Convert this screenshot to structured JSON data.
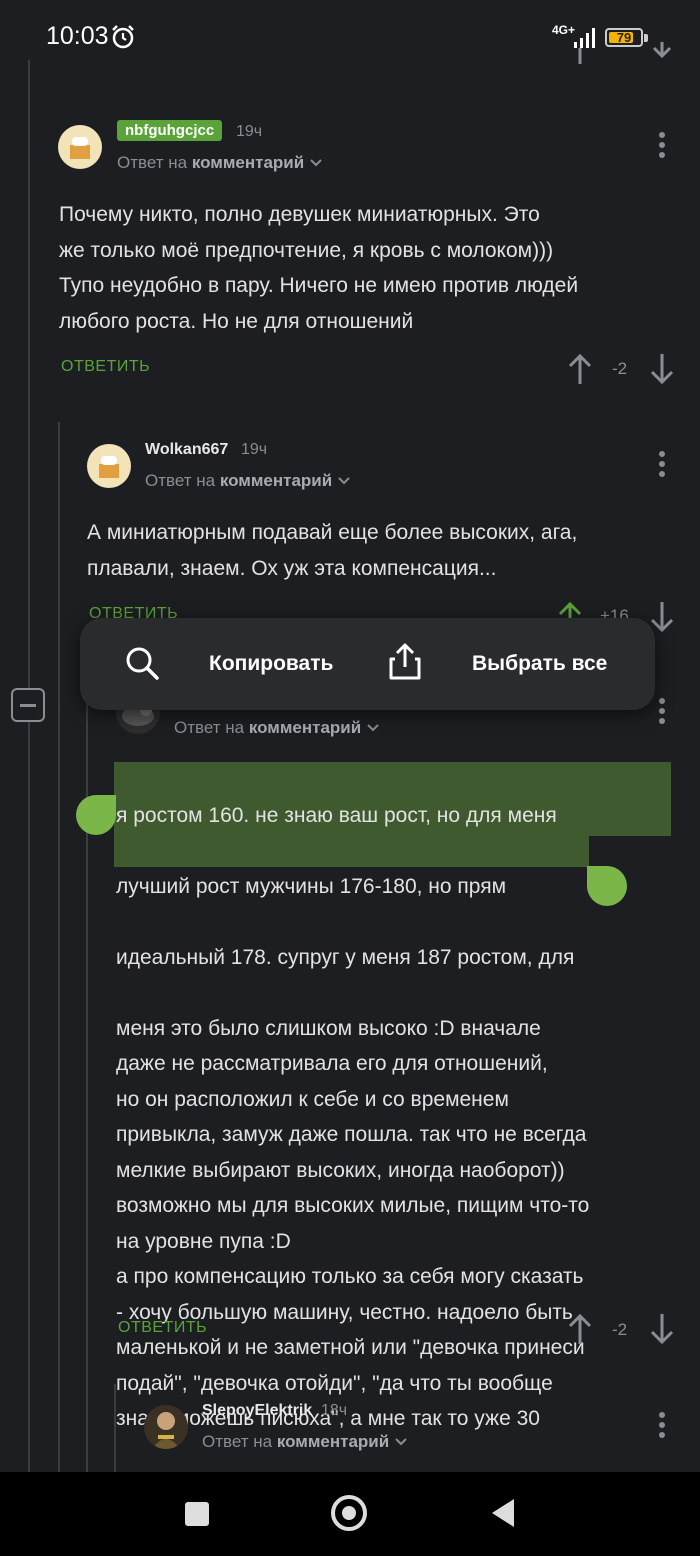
{
  "status_bar": {
    "time": "10:03",
    "network": "4G+",
    "battery": "79",
    "battery_level": 0.79
  },
  "comments": [
    {
      "username": "nbfguhgcjcc",
      "age": "19ч",
      "reply_prefix": "Ответ на",
      "reply_target": "комментарий",
      "text": "Почему никто, полно девушек миниатюрных. Это\nже только моё предпочтение, я кровь с молоком)))\nТупо неудобно в пару. Ничего не имею против людей\nлюбого роста. Но не для отношений",
      "reply_label": "ОТВЕТИТЬ",
      "score": "-2"
    },
    {
      "username": "Wolkan667",
      "age": "19ч",
      "reply_prefix": "Ответ на",
      "reply_target": "комментарий",
      "text": "А миниатюрным подавай еще более высоких, ага,\nплавали, знаем. Ох уж эта компенсация...",
      "reply_label": "ОТВЕТИТЬ",
      "score": "+16"
    },
    {
      "reply_prefix": "Ответ на",
      "reply_target": "комментарий",
      "text_selected_1": "я ростом 160. не знаю ваш рост, но для меня",
      "text_selected_2": "лучший рост мужчины 176-180, но прям",
      "text_selected_3": "идеальный 178. супруг у меня 187 ростом",
      "text_after_selection": ", для",
      "text_rest": "меня это было слишком высоко :D вначале\nдаже не рассматривала его для отношений,\nно он расположил к себе и со временем\nпривыкла, замуж даже пошла. так что не всегда\nмелкие выбирают высоких, иногда наоборот))\nвозможно мы для высоких милые, пищим что-то\nна уровне пупа :D\nа про компенсацию только за себя могу сказать\n- хочу большую машину, честно. надоело быть\nмаленькой и не заметной или \"девочка принеси\nподай\", \"девочка отойди\", \"да что ты вообще\nзнать можешь писюха\", а мне так то уже 30",
      "reply_label": "ОТВЕТИТЬ",
      "score": "-2"
    },
    {
      "username": "SlepoyElektrik",
      "age": "18ч",
      "reply_prefix": "Ответ на",
      "reply_target": "комментарий"
    }
  ],
  "context_menu": {
    "copy": "Копировать",
    "select_all": "Выбрать все"
  },
  "icons": {
    "search": "search-icon",
    "share": "share-icon",
    "more": "more-vertical-icon",
    "up": "arrow-up-icon",
    "down": "arrow-down-icon",
    "collapse": "collapse-minus-icon"
  },
  "colors": {
    "accent": "#5aa338",
    "background": "#1c1e22",
    "highlight": "#3f5a2e",
    "handle": "#7ab648"
  }
}
